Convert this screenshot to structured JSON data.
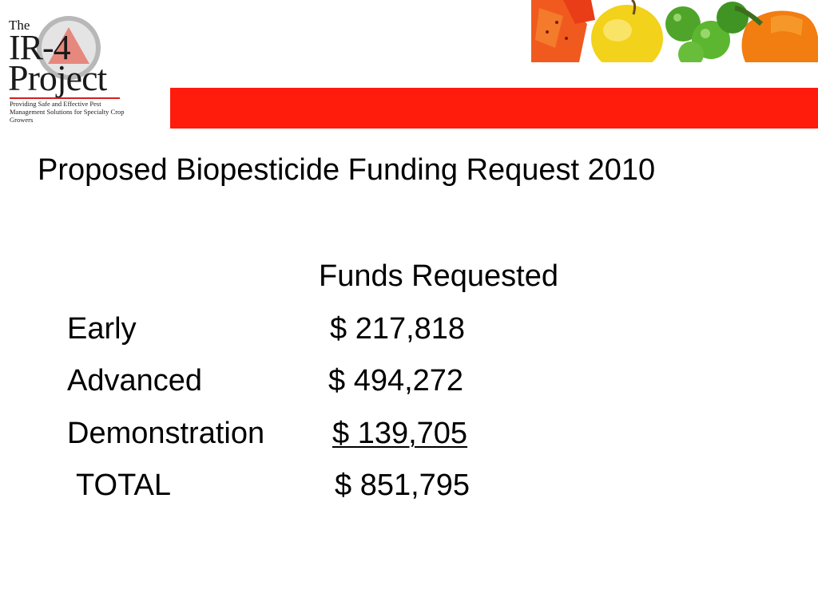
{
  "logo": {
    "line1": "The",
    "line2": "IR-4",
    "line3": "Project",
    "tagline": "Providing Safe and Effective Pest Management Solutions for Specialty Crop Growers"
  },
  "banner": {
    "accent_color": "#ff1c0d",
    "image_desc": "produce-photo"
  },
  "slide": {
    "title": "Proposed Biopesticide Funding Request 2010",
    "column_header": "Funds Requested",
    "rows": [
      {
        "label": "Early",
        "amount": "$ 217,818"
      },
      {
        "label": "Advanced",
        "amount": "$ 494,272"
      },
      {
        "label": "Demonstration",
        "amount": "$ 139,705"
      },
      {
        "label": "TOTAL",
        "amount": "$ 851,795"
      }
    ]
  }
}
